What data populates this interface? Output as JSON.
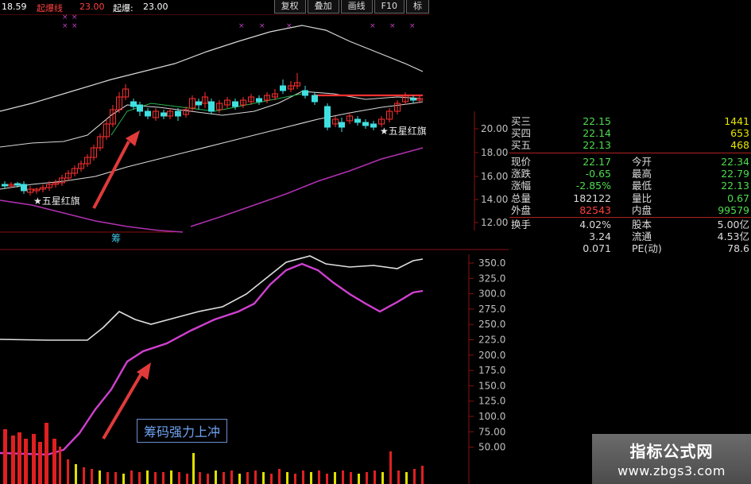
{
  "top_bar": {
    "ma_value_1": "18.59",
    "ma_name": "起爆线",
    "ma_value_2": "23.00",
    "ma_name_b": "起爆:",
    "ma_value_3": "23.00"
  },
  "toolbar": {
    "buttons": [
      "复权",
      "叠加",
      "画线",
      "F10",
      "标"
    ]
  },
  "price_axis": [
    "20.00",
    "18.00",
    "16.00",
    "14.00",
    "12.00"
  ],
  "lower_axis": [
    "350.0",
    "325.0",
    "300.0",
    "275.0",
    "250.0",
    "225.0",
    "200.0",
    "175.0",
    "150.0",
    "125.0",
    "100.0",
    "75.00",
    "50.00"
  ],
  "signals": {
    "left": "★五星红旗",
    "right": "★五星红旗"
  },
  "annotation": "筹码强力上冲",
  "small_label": "筹",
  "quote": {
    "book": [
      {
        "label": "买三",
        "price": "22.15",
        "vol": "1441"
      },
      {
        "label": "买四",
        "price": "22.14",
        "vol": "653"
      },
      {
        "label": "买五",
        "price": "22.13",
        "vol": "468"
      }
    ],
    "stats": [
      {
        "l1": "现价",
        "v1": "22.17",
        "c1": "#4fdc4f",
        "l2": "今开",
        "v2": "22.34",
        "c2": "#4fdc4f"
      },
      {
        "l1": "涨跌",
        "v1": "-0.65",
        "c1": "#4fdc4f",
        "l2": "最高",
        "v2": "22.79",
        "c2": "#4fdc4f"
      },
      {
        "l1": "涨幅",
        "v1": "-2.85%",
        "c1": "#4fdc4f",
        "l2": "最低",
        "v2": "22.13",
        "c2": "#4fdc4f"
      },
      {
        "l1": "总量",
        "v1": "182122",
        "c1": "#dcdcdc",
        "l2": "量比",
        "v2": "0.67",
        "c2": "#4fdc4f"
      },
      {
        "l1": "外盘",
        "v1": "82543",
        "c1": "#ff4040",
        "l2": "内盘",
        "v2": "99579",
        "c2": "#4fdc4f"
      },
      {
        "l1": "换手",
        "v1": "4.02%",
        "c1": "#dcdcdc",
        "l2": "股本",
        "v2": "5.00亿",
        "c2": "#dcdcdc"
      },
      {
        "l1": "",
        "v1": "3.24",
        "c1": "#dcdcdc",
        "l2": "流通",
        "v2": "4.53亿",
        "c2": "#dcdcdc"
      },
      {
        "l1": "",
        "v1": "0.071",
        "c1": "#dcdcdc",
        "l2": "PE(动)",
        "v2": "78.6",
        "c2": "#dcdcdc"
      }
    ]
  },
  "watermark": {
    "title": "指标公式网",
    "url": "www.zbgs3.com"
  },
  "colors": {
    "up": "#ff3030",
    "down": "#40e0e0",
    "indicator_purple": "#d040d0",
    "indicator_white": "#e0e0e0",
    "arrow": "#e03a3a"
  }
}
